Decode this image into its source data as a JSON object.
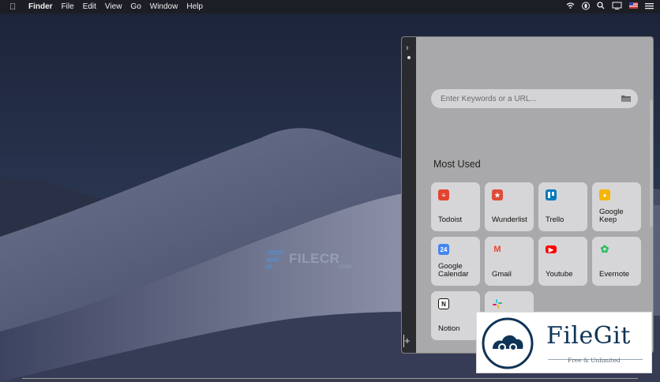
{
  "menubar": {
    "apple_icon": "apple-icon",
    "items": [
      "Finder",
      "File",
      "Edit",
      "View",
      "Go",
      "Window",
      "Help"
    ],
    "status_icons": [
      "wifi-icon",
      "battery-icon",
      "search-icon",
      "display-icon",
      "us-flag-icon",
      "list-icon"
    ]
  },
  "watermark_filecr": {
    "text": "FILECR",
    "suffix": ".com"
  },
  "panel": {
    "search": {
      "placeholder": "Enter Keywords or a URL...",
      "value": ""
    },
    "section_title": "Most Used",
    "tiles": [
      {
        "label": "Todoist",
        "icon": "todoist-icon",
        "color": "#e44332"
      },
      {
        "label": "Wunderlist",
        "icon": "wunderlist-icon",
        "color": "#dd4b39"
      },
      {
        "label": "Trello",
        "icon": "trello-icon",
        "color": "#0079bf"
      },
      {
        "label": "Google Keep",
        "icon": "google-keep-icon",
        "color": "#f6b400"
      },
      {
        "label": "Google Calendar",
        "icon": "google-calendar-icon",
        "color": "#4285f4"
      },
      {
        "label": "Gmail",
        "icon": "gmail-icon",
        "color": "#ea4335"
      },
      {
        "label": "Youtube",
        "icon": "youtube-icon",
        "color": "#ff0000"
      },
      {
        "label": "Evernote",
        "icon": "evernote-icon",
        "color": "#2dbe60"
      },
      {
        "label": "Notion",
        "icon": "notion-icon",
        "color": "#111111"
      },
      {
        "label": "",
        "icon": "slack-icon",
        "color": "#e01e5a"
      }
    ]
  },
  "filegit": {
    "brand": "FileGit",
    "tagline": "Free & Unlimited"
  }
}
